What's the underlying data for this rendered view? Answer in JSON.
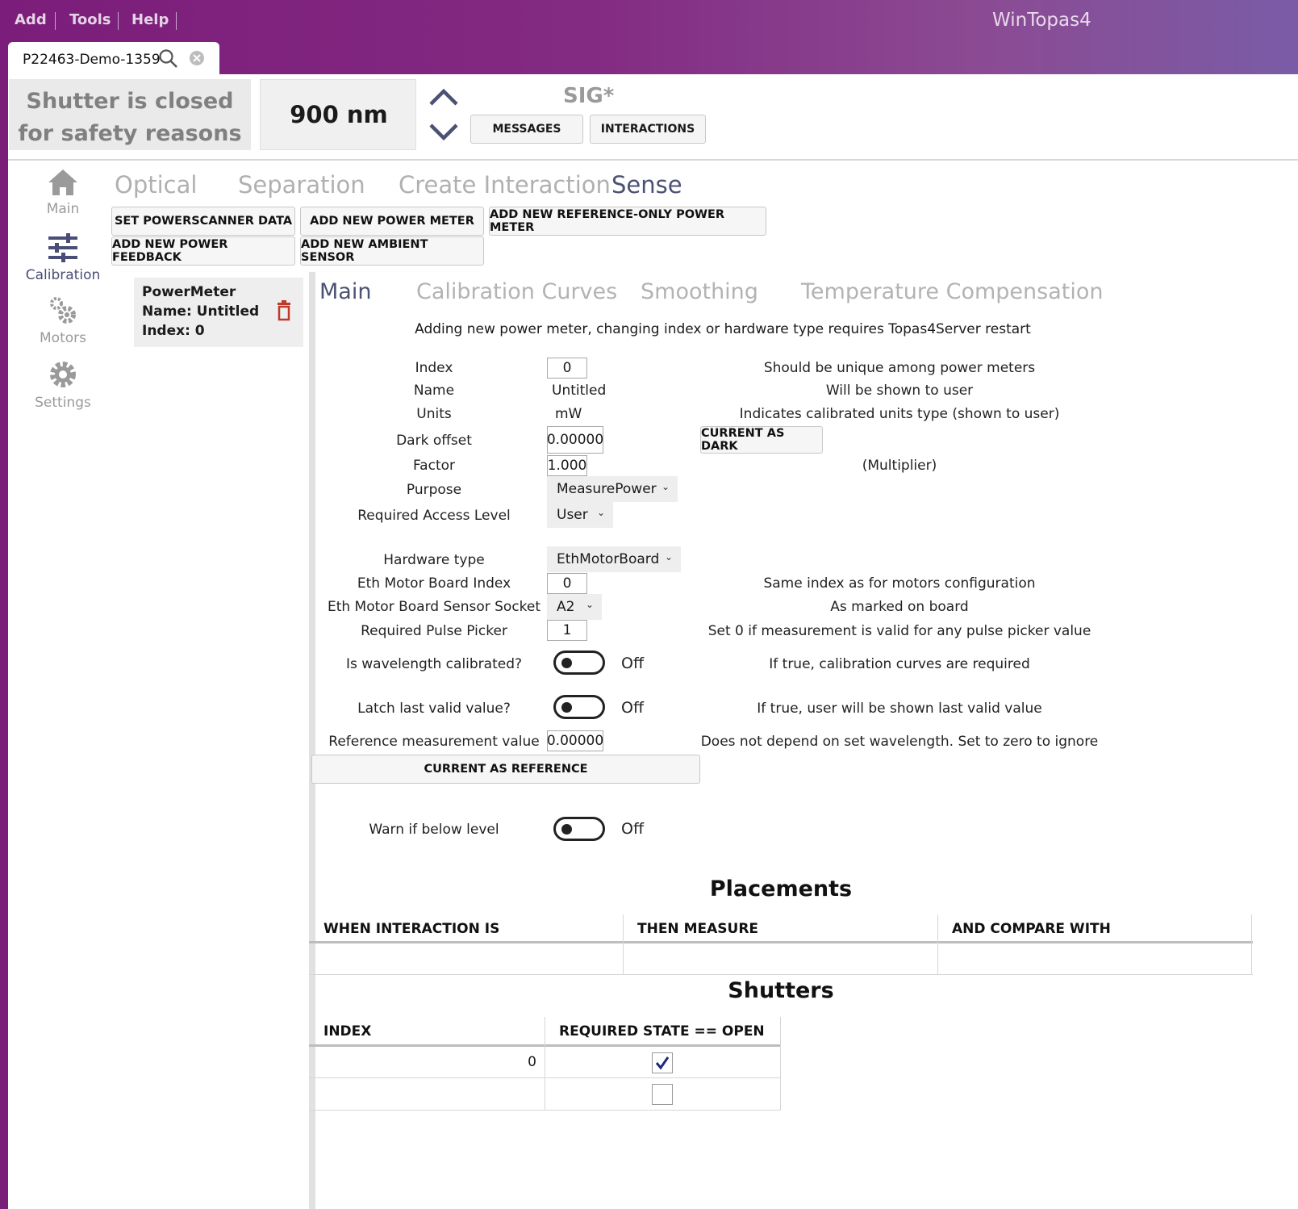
{
  "menu": {
    "add": "Add",
    "tools": "Tools",
    "help": "Help"
  },
  "app_title": "WinTopas4",
  "tab": {
    "label": "P22463-Demo-1359"
  },
  "status": {
    "shutter_line1": "Shutter is closed",
    "shutter_line2": "for safety reasons",
    "wavelength": "900 nm",
    "sig": "SIG*",
    "messages_label": "MESSAGES",
    "interactions_label": "INTERACTIONS"
  },
  "nav": [
    {
      "label": "Main"
    },
    {
      "label": "Calibration"
    },
    {
      "label": "Motors"
    },
    {
      "label": "Settings"
    }
  ],
  "top_tabs": [
    "Optical",
    "Separation",
    "Create Interaction",
    "Sense"
  ],
  "actions": {
    "set_powerscanner": "SET POWERSCANNER DATA",
    "add_power_meter": "ADD NEW POWER METER",
    "add_ref_meter": "ADD NEW REFERENCE-ONLY POWER METER",
    "add_power_feedback": "ADD NEW POWER FEEDBACK",
    "add_ambient": "ADD NEW AMBIENT SENSOR"
  },
  "device": {
    "type": "PowerMeter",
    "name_line": "Name:  Untitled",
    "index_line": "Index:  0"
  },
  "sub_tabs": [
    "Main",
    "Calibration Curves",
    "Smoothing",
    "Temperature Compensation"
  ],
  "notice": "Adding new power meter, changing index or hardware type requires Topas4Server restart",
  "form": {
    "index": {
      "label": "Index",
      "value": "0",
      "note": "Should be unique among power meters"
    },
    "name": {
      "label": "Name",
      "value": "Untitled",
      "note": "Will be shown to user"
    },
    "units": {
      "label": "Units",
      "value": "mW",
      "note": "Indicates calibrated units type (shown to user)"
    },
    "dark_offset": {
      "label": "Dark offset",
      "value": "0.00000",
      "button": "CURRENT AS DARK"
    },
    "factor": {
      "label": "Factor",
      "value": "1.000",
      "note": "(Multiplier)"
    },
    "purpose": {
      "label": "Purpose",
      "value": "MeasurePower"
    },
    "access": {
      "label": "Required Access Level",
      "value": "User"
    },
    "hardware": {
      "label": "Hardware type",
      "value": "EthMotorBoard"
    },
    "board_index": {
      "label": "Eth Motor Board Index",
      "value": "0",
      "note": "Same index as for motors configuration"
    },
    "socket": {
      "label": "Eth Motor Board Sensor Socket",
      "value": "A2",
      "note": "As marked on board"
    },
    "pulse_picker": {
      "label": "Required Pulse Picker",
      "value": "1",
      "note": "Set 0 if measurement is valid for any pulse picker value"
    },
    "wl_calibrated": {
      "label": "Is wavelength calibrated?",
      "state": "Off",
      "note": "If true, calibration curves are required"
    },
    "latch": {
      "label": "Latch last valid value?",
      "state": "Off",
      "note": "If true, user will be shown last valid value"
    },
    "reference": {
      "label": "Reference measurement value",
      "value": "0.00000",
      "note": "Does not depend on set wavelength. Set to zero to ignore",
      "button": "CURRENT AS REFERENCE"
    },
    "warn": {
      "label": "Warn if below level",
      "state": "Off"
    }
  },
  "placements": {
    "title": "Placements",
    "columns": [
      "WHEN INTERACTION IS",
      "THEN MEASURE",
      "AND COMPARE WITH"
    ]
  },
  "shutters": {
    "title": "Shutters",
    "columns": [
      "INDEX",
      "REQUIRED STATE == OPEN"
    ],
    "rows": [
      {
        "index": "0",
        "open": true
      },
      {
        "index": "",
        "open": false
      }
    ]
  },
  "colors": {
    "titlebar": "#7b1d7a",
    "accent": "#4b5173",
    "delete": "#c0392b"
  }
}
